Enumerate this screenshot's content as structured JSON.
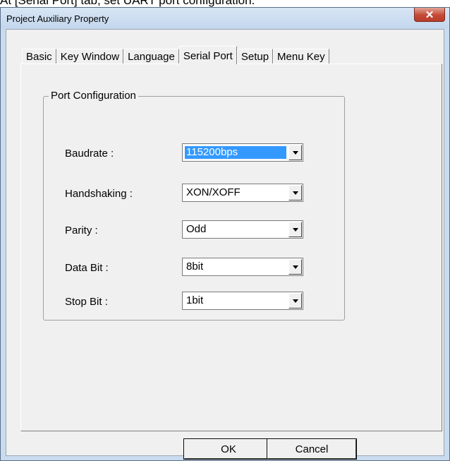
{
  "caption": "At [Serial Port] tab, set UART port configuration.",
  "window": {
    "title": "Project Auxiliary Property",
    "close_glyph": "✕"
  },
  "tabs": [
    {
      "label": "Basic"
    },
    {
      "label": "Key Window"
    },
    {
      "label": "Language"
    },
    {
      "label": "Serial Port",
      "active": true
    },
    {
      "label": "Setup"
    },
    {
      "label": "Menu Key"
    }
  ],
  "group": {
    "title": "Port Configuration",
    "fields": [
      {
        "label": "Baudrate :",
        "value": "115200bps"
      },
      {
        "label": "Handshaking :",
        "value": "XON/XOFF"
      },
      {
        "label": "Parity :",
        "value": "Odd"
      },
      {
        "label": "Data Bit :",
        "value": "8bit"
      },
      {
        "label": "Stop Bit :",
        "value": "1bit"
      }
    ]
  },
  "buttons": {
    "ok": "OK",
    "cancel": "Cancel"
  },
  "colors": {
    "selection": "#3399ff",
    "close_button": "#c44a37",
    "frame": "#c9dcef"
  }
}
